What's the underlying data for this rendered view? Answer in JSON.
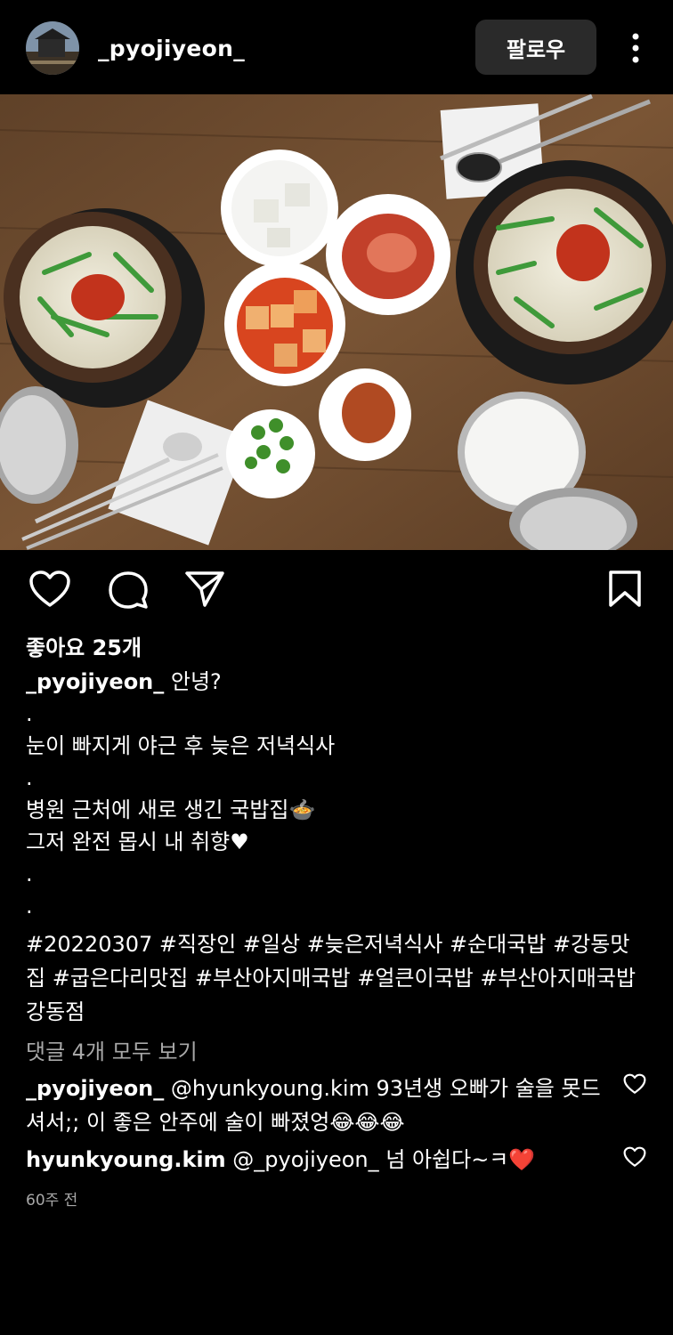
{
  "header": {
    "username": "_pyojiyeon_",
    "follow_label": "팔로우"
  },
  "icons": {
    "more": "more-vertical-icon",
    "like": "heart-outline-icon",
    "comment": "comment-bubble-icon",
    "share": "paper-plane-icon",
    "save": "bookmark-outline-icon"
  },
  "post": {
    "likes": "좋아요 25개",
    "caption": {
      "username": "_pyojiyeon_",
      "first_line": " 안녕?",
      "lines": [
        ".",
        "눈이 빠지게 야근 후 늦은 저녁식사",
        ".",
        "병원 근처에 새로 생긴 국밥집🍲",
        "그저 완전 몹시 내 취향♥",
        ".",
        "."
      ],
      "hashtags": "#20220307 #직장인 #일상 #늦은저녁식사 #순대국밥 #강동맛집 #굽은다리맛집 #부산아지매국밥 #얼큰이국밥 #부산아지매국밥강동점"
    },
    "view_comments": "댓글 4개 모두 보기",
    "comments": [
      {
        "username": "_pyojiyeon_",
        "text": " @hyunkyoung.kim 93년생 오빠가 술을 못드셔서;; 이 좋은 안주에 술이 빠졌엉😂😂😂"
      },
      {
        "username": "hyunkyoung.kim",
        "text": " @_pyojiyeon_ 넘  아쉽다~ㅋ❤️"
      }
    ],
    "time": "60주 전"
  },
  "colors": {
    "background": "#000000",
    "follow_button": "#2a2a2a",
    "muted_text": "#a8a8a8",
    "table_wood": "#6b4a2e"
  }
}
